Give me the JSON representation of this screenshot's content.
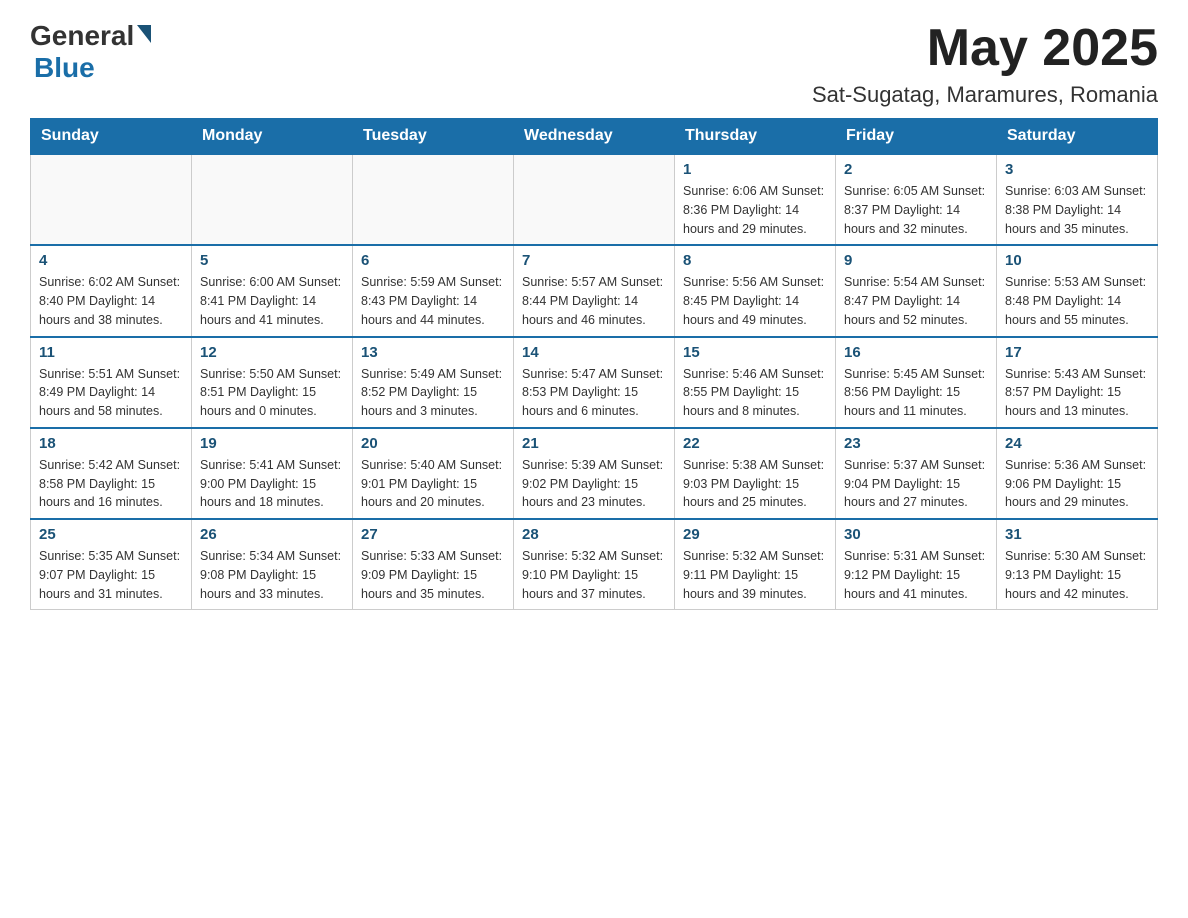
{
  "header": {
    "logo": {
      "general": "General",
      "blue": "Blue"
    },
    "month_title": "May 2025",
    "location": "Sat-Sugatag, Maramures, Romania"
  },
  "days_of_week": [
    "Sunday",
    "Monday",
    "Tuesday",
    "Wednesday",
    "Thursday",
    "Friday",
    "Saturday"
  ],
  "weeks": [
    [
      {
        "day": "",
        "info": ""
      },
      {
        "day": "",
        "info": ""
      },
      {
        "day": "",
        "info": ""
      },
      {
        "day": "",
        "info": ""
      },
      {
        "day": "1",
        "info": "Sunrise: 6:06 AM\nSunset: 8:36 PM\nDaylight: 14 hours and 29 minutes."
      },
      {
        "day": "2",
        "info": "Sunrise: 6:05 AM\nSunset: 8:37 PM\nDaylight: 14 hours and 32 minutes."
      },
      {
        "day": "3",
        "info": "Sunrise: 6:03 AM\nSunset: 8:38 PM\nDaylight: 14 hours and 35 minutes."
      }
    ],
    [
      {
        "day": "4",
        "info": "Sunrise: 6:02 AM\nSunset: 8:40 PM\nDaylight: 14 hours and 38 minutes."
      },
      {
        "day": "5",
        "info": "Sunrise: 6:00 AM\nSunset: 8:41 PM\nDaylight: 14 hours and 41 minutes."
      },
      {
        "day": "6",
        "info": "Sunrise: 5:59 AM\nSunset: 8:43 PM\nDaylight: 14 hours and 44 minutes."
      },
      {
        "day": "7",
        "info": "Sunrise: 5:57 AM\nSunset: 8:44 PM\nDaylight: 14 hours and 46 minutes."
      },
      {
        "day": "8",
        "info": "Sunrise: 5:56 AM\nSunset: 8:45 PM\nDaylight: 14 hours and 49 minutes."
      },
      {
        "day": "9",
        "info": "Sunrise: 5:54 AM\nSunset: 8:47 PM\nDaylight: 14 hours and 52 minutes."
      },
      {
        "day": "10",
        "info": "Sunrise: 5:53 AM\nSunset: 8:48 PM\nDaylight: 14 hours and 55 minutes."
      }
    ],
    [
      {
        "day": "11",
        "info": "Sunrise: 5:51 AM\nSunset: 8:49 PM\nDaylight: 14 hours and 58 minutes."
      },
      {
        "day": "12",
        "info": "Sunrise: 5:50 AM\nSunset: 8:51 PM\nDaylight: 15 hours and 0 minutes."
      },
      {
        "day": "13",
        "info": "Sunrise: 5:49 AM\nSunset: 8:52 PM\nDaylight: 15 hours and 3 minutes."
      },
      {
        "day": "14",
        "info": "Sunrise: 5:47 AM\nSunset: 8:53 PM\nDaylight: 15 hours and 6 minutes."
      },
      {
        "day": "15",
        "info": "Sunrise: 5:46 AM\nSunset: 8:55 PM\nDaylight: 15 hours and 8 minutes."
      },
      {
        "day": "16",
        "info": "Sunrise: 5:45 AM\nSunset: 8:56 PM\nDaylight: 15 hours and 11 minutes."
      },
      {
        "day": "17",
        "info": "Sunrise: 5:43 AM\nSunset: 8:57 PM\nDaylight: 15 hours and 13 minutes."
      }
    ],
    [
      {
        "day": "18",
        "info": "Sunrise: 5:42 AM\nSunset: 8:58 PM\nDaylight: 15 hours and 16 minutes."
      },
      {
        "day": "19",
        "info": "Sunrise: 5:41 AM\nSunset: 9:00 PM\nDaylight: 15 hours and 18 minutes."
      },
      {
        "day": "20",
        "info": "Sunrise: 5:40 AM\nSunset: 9:01 PM\nDaylight: 15 hours and 20 minutes."
      },
      {
        "day": "21",
        "info": "Sunrise: 5:39 AM\nSunset: 9:02 PM\nDaylight: 15 hours and 23 minutes."
      },
      {
        "day": "22",
        "info": "Sunrise: 5:38 AM\nSunset: 9:03 PM\nDaylight: 15 hours and 25 minutes."
      },
      {
        "day": "23",
        "info": "Sunrise: 5:37 AM\nSunset: 9:04 PM\nDaylight: 15 hours and 27 minutes."
      },
      {
        "day": "24",
        "info": "Sunrise: 5:36 AM\nSunset: 9:06 PM\nDaylight: 15 hours and 29 minutes."
      }
    ],
    [
      {
        "day": "25",
        "info": "Sunrise: 5:35 AM\nSunset: 9:07 PM\nDaylight: 15 hours and 31 minutes."
      },
      {
        "day": "26",
        "info": "Sunrise: 5:34 AM\nSunset: 9:08 PM\nDaylight: 15 hours and 33 minutes."
      },
      {
        "day": "27",
        "info": "Sunrise: 5:33 AM\nSunset: 9:09 PM\nDaylight: 15 hours and 35 minutes."
      },
      {
        "day": "28",
        "info": "Sunrise: 5:32 AM\nSunset: 9:10 PM\nDaylight: 15 hours and 37 minutes."
      },
      {
        "day": "29",
        "info": "Sunrise: 5:32 AM\nSunset: 9:11 PM\nDaylight: 15 hours and 39 minutes."
      },
      {
        "day": "30",
        "info": "Sunrise: 5:31 AM\nSunset: 9:12 PM\nDaylight: 15 hours and 41 minutes."
      },
      {
        "day": "31",
        "info": "Sunrise: 5:30 AM\nSunset: 9:13 PM\nDaylight: 15 hours and 42 minutes."
      }
    ]
  ]
}
